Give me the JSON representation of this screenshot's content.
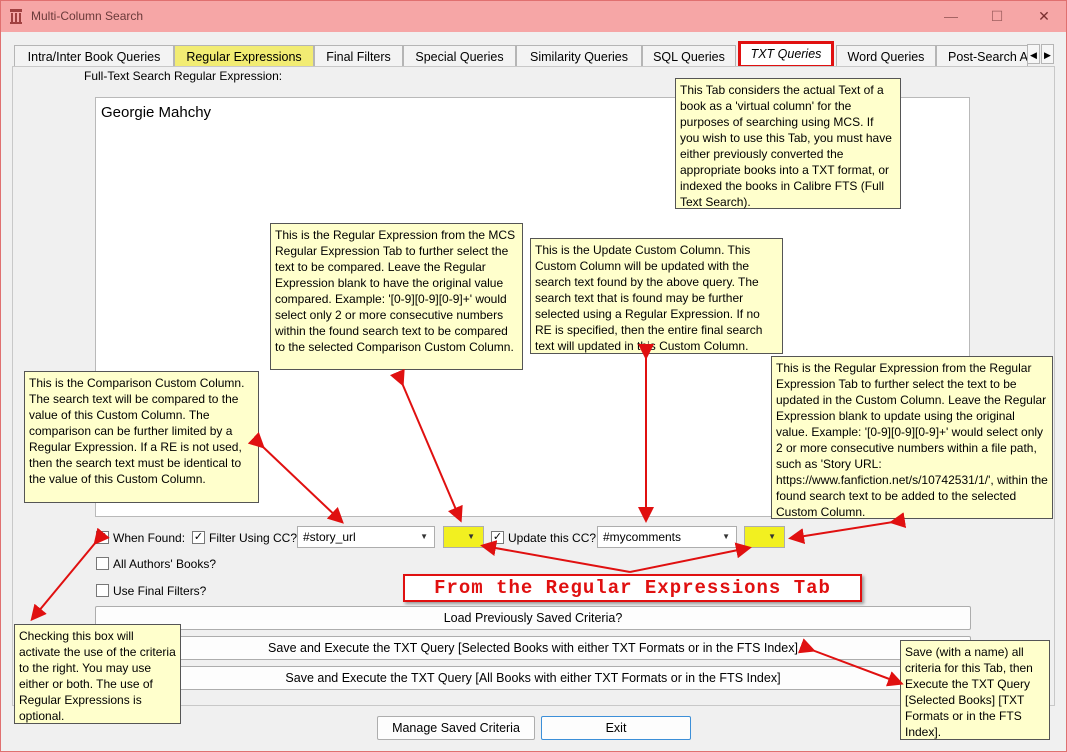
{
  "window": {
    "title": "Multi-Column Search",
    "minimize": "—",
    "maximize": "☐",
    "close": "✕"
  },
  "tabs": [
    {
      "label": "Intra/Inter Book Queries"
    },
    {
      "label": "Regular Expressions"
    },
    {
      "label": "Final Filters"
    },
    {
      "label": "Special Queries"
    },
    {
      "label": "Similarity Queries"
    },
    {
      "label": "SQL Queries"
    },
    {
      "label": "TXT Queries"
    },
    {
      "label": "Word Queries"
    },
    {
      "label": "Post-Search A"
    }
  ],
  "tab_arrows": {
    "left": "◀",
    "right": "▶"
  },
  "main": {
    "fts_label": "Full-Text Search Regular Expression:",
    "fts_value": "Georgie Mahchy",
    "when_found_label": "When Found:",
    "when_found_checked": "✓",
    "filter_cc_label": "Filter Using CC?",
    "filter_cc_checked": "✓",
    "compare_cc_value": "#story_url",
    "update_cc_label": "Update this CC?",
    "update_cc_checked": "✓",
    "update_cc_value": "#mycomments",
    "dropdown_arrow": "▼",
    "all_authors_label": "All Authors' Books?",
    "final_filters_label": "Use Final Filters?",
    "load_button": "Load Previously Saved Criteria?",
    "save_selected_button": "Save and Execute the TXT Query [Selected Books with either TXT Formats or in the FTS Index]",
    "save_all_button": "Save and Execute the TXT Query [All Books with either TXT Formats or in the FTS Index]",
    "manage_button": "Manage Saved Criteria",
    "exit_button": "Exit"
  },
  "annotations": {
    "tab_note": "This Tab considers the actual Text of a book as a 'virtual column' for the purposes of searching using MCS. If you wish to use this Tab, you must have either previously converted the appropriate books into a TXT format, or indexed the books in Calibre FTS (Full Text Search).",
    "regex_note": "This is the Regular Expression from the MCS Regular Expression Tab to further select the text to be compared. Leave the Regular Expression blank to have the original value compared. Example: '[0-9][0-9][0-9]+' would select only 2 or more consecutive numbers within the found search text to be compared to the selected Comparison Custom Column.",
    "update_note": "This is the Update Custom Column. This Custom Column will be updated with the search text found by the above query. The search text that is found may be further selected using a Regular Expression. If no RE is specified, then the entire final search text will updated in this Custom Column.",
    "compare_note": "This is the Comparison Custom Column. The search text will be compared to the value of this Custom Column. The comparison can be further limited by a Regular Expression. If a RE is not used, then the search text must be identical to the value of this Custom Column.",
    "regex2_note": "This is the Regular Expression from the Regular Expression Tab to further select the text to be updated in the Custom Column. Leave the Regular Expression blank to update using the original value. Example: '[0-9][0-9][0-9]+' would select only 2 or more consecutive numbers within a file path, such as 'Story URL: https://www.fanfiction.net/s/10742531/1/', within the found search text to be added to the selected Custom Column.",
    "checkbox_note": "Checking this box will activate the use of the criteria to the right. You may use either or both. The use of Regular Expressions is optional.",
    "save_note": "Save (with a name) all criteria for this Tab, then Execute the TXT Query [Selected Books] [TXT Formats or in the FTS Index].",
    "banner": "From the Regular Expressions Tab"
  },
  "colors": {
    "titlebar": "#f6a6a6",
    "highlight_tab": "#f2ec73",
    "yellow_combo": "#f2f020",
    "note_bg": "#ffffcc",
    "red": "#e01010"
  }
}
